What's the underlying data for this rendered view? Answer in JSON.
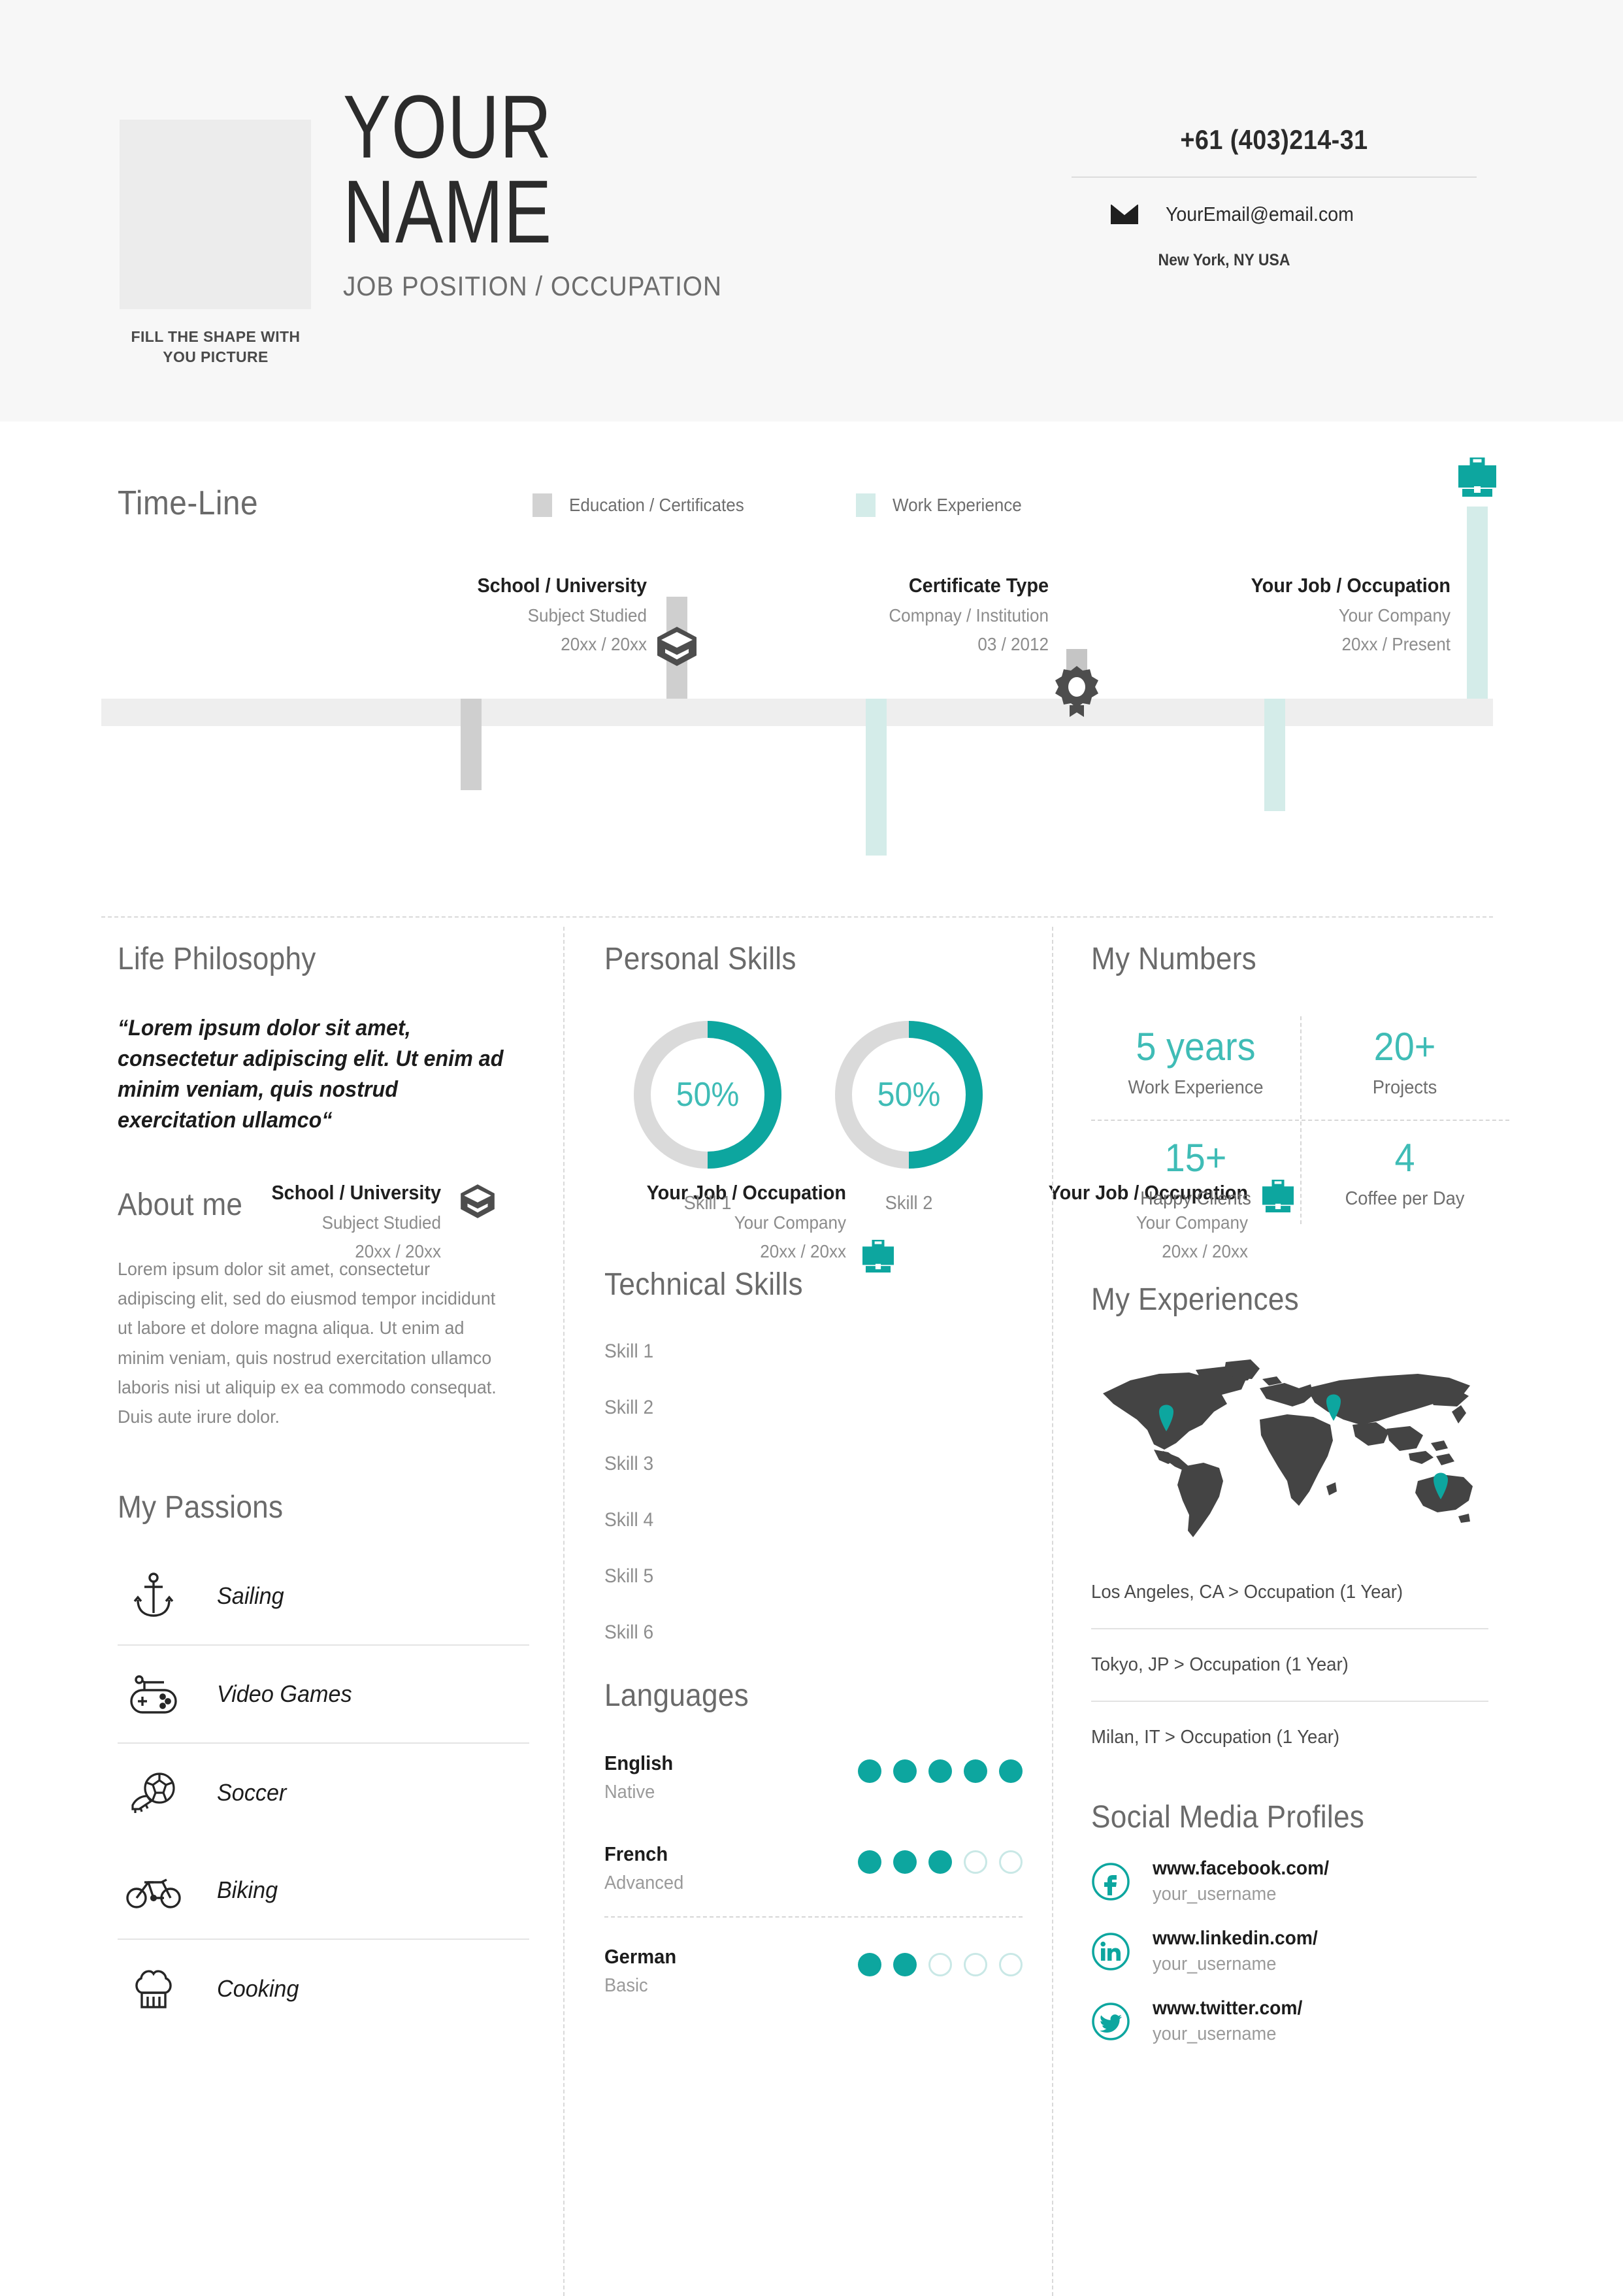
{
  "header": {
    "name_line1": "YOUR",
    "name_line2": "NAME",
    "job_title": "JOB POSITION / OCCUPATION",
    "photo_caption_line1": "FILL THE SHAPE WITH",
    "photo_caption_line2": "YOU PICTURE",
    "phone": "+61 (403)214-31",
    "email": "YourEmail@email.com",
    "location": "New York, NY USA",
    "email_icon": "envelope-icon"
  },
  "timeline": {
    "title": "Time-Line",
    "legend": [
      {
        "label": "Education / Certificates",
        "color": "#d2d2d2"
      },
      {
        "label": "Work Experience",
        "color": "#d4ece9"
      }
    ],
    "items_above": [
      {
        "heading": "School / University",
        "sub": "Subject Studied",
        "date": "20xx / 20xx",
        "icon": "graduation-cap-icon",
        "kind": "education"
      },
      {
        "heading": "Certificate Type",
        "sub": "Compnay / Institution",
        "date": "03 / 2012",
        "icon": "certificate-badge-icon",
        "kind": "education"
      },
      {
        "heading": "Your Job / Occupation",
        "sub": "Your Company",
        "date": "20xx / Present",
        "icon": "briefcase-icon",
        "kind": "work"
      }
    ],
    "items_below": [
      {
        "heading": "School / University",
        "sub": "Subject Studied",
        "date": "20xx / 20xx",
        "icon": "graduation-cap-icon",
        "kind": "education"
      },
      {
        "heading": "Your Job / Occupation",
        "sub": "Your Company",
        "date": "20xx / 20xx",
        "icon": "briefcase-icon",
        "kind": "work"
      },
      {
        "heading": "Your Job / Occupation",
        "sub": "Your Company",
        "date": "20xx / 20xx",
        "icon": "briefcase-icon",
        "kind": "work"
      }
    ]
  },
  "life_philosophy": {
    "title": "Life Philosophy",
    "quote": "“Lorem ipsum dolor sit amet, consectetur adipiscing elit. Ut enim ad minim veniam, quis nostrud exercitation ullamco“"
  },
  "about_me": {
    "title": "About me",
    "text": "Lorem ipsum dolor sit amet, consectetur adipiscing elit, sed do eiusmod tempor incididunt ut labore et dolore magna aliqua. Ut enim ad minim veniam, quis nostrud exercitation ullamco laboris nisi ut aliquip ex ea commodo consequat. Duis aute irure dolor."
  },
  "passions": {
    "title": "My Passions",
    "items": [
      {
        "label": "Sailing",
        "icon": "anchor-icon"
      },
      {
        "label": "Video Games",
        "icon": "gamepad-icon"
      },
      {
        "label": "Soccer",
        "icon": "soccer-ball-icon"
      },
      {
        "label": "Biking",
        "icon": "bicycle-icon"
      },
      {
        "label": "Cooking",
        "icon": "chef-hat-icon"
      }
    ]
  },
  "personal_skills": {
    "title": "Personal Skills",
    "items": [
      {
        "label": "Skill 1",
        "percent": "50%",
        "value": 50
      },
      {
        "label": "Skill 2",
        "percent": "50%",
        "value": 50
      }
    ]
  },
  "technical_skills": {
    "title": "Technical Skills",
    "items": [
      "Skill 1",
      "Skill 2",
      "Skill 3",
      "Skill 4",
      "Skill 5",
      "Skill 6"
    ]
  },
  "languages": {
    "title": "Languages",
    "items": [
      {
        "name": "English",
        "level": "Native",
        "filled": 5,
        "total": 5
      },
      {
        "name": "French",
        "level": "Advanced",
        "filled": 3,
        "total": 5
      },
      {
        "name": "German",
        "level": "Basic",
        "filled": 2,
        "total": 5
      }
    ]
  },
  "my_numbers": {
    "title": "My Numbers",
    "items": [
      {
        "value": "5 years",
        "label": "Work Experience"
      },
      {
        "value": "20+",
        "label": "Projects"
      },
      {
        "value": "15+",
        "label": "Happy Clients"
      },
      {
        "value": "4",
        "label": "Coffee per Day"
      }
    ]
  },
  "my_experiences": {
    "title": "My Experiences",
    "map_icon": "world-map",
    "pins": [
      "north-america-pin",
      "europe-pin",
      "australia-pin"
    ],
    "items": [
      "Los Angeles, CA > Occupation (1 Year)",
      "Tokyo, JP > Occupation (1 Year)",
      "Milan, IT > Occupation (1 Year)"
    ]
  },
  "social": {
    "title": "Social Media Profiles",
    "items": [
      {
        "url": "www.facebook.com/",
        "username": "your_username",
        "icon": "facebook-icon"
      },
      {
        "url": "www.linkedin.com/",
        "username": "your_username",
        "icon": "linkedin-icon"
      },
      {
        "url": "www.twitter.com/",
        "username": "your_username",
        "icon": "twitter-icon"
      }
    ]
  },
  "colors": {
    "accent_teal": "#0da69f",
    "accent_light_teal": "#3fbcb6",
    "header_bg": "#f7f7f7",
    "work_bar": "#d4ece9",
    "edu_bar": "#cfcfcf",
    "map_dark": "#444444"
  }
}
